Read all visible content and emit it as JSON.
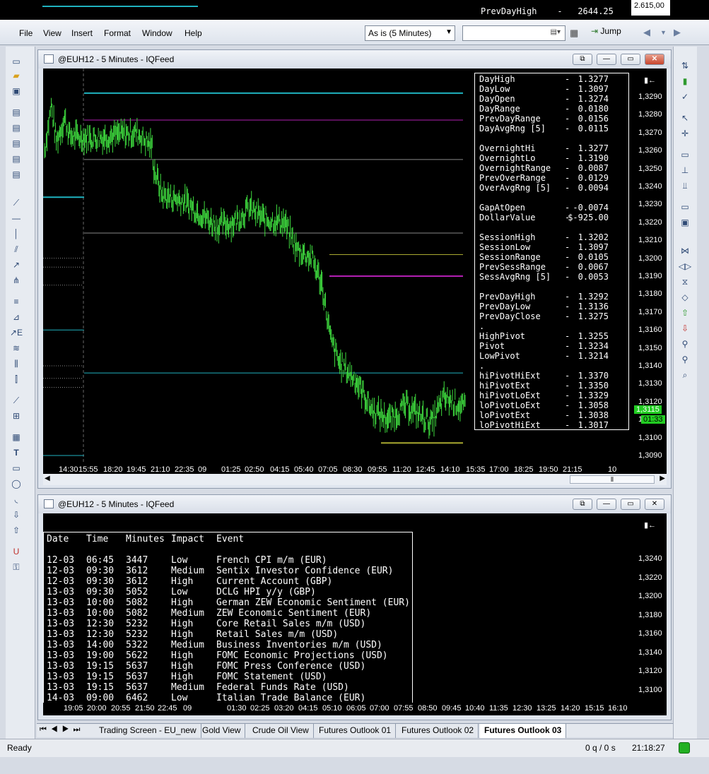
{
  "background_window": {
    "label": "PrevDayHigh",
    "dash": "-",
    "value": "2644.25",
    "axis": "2.615,00"
  },
  "menu": {
    "file": "File",
    "view": "View",
    "insert": "Insert",
    "format": "Format",
    "window": "Window",
    "help": "Help"
  },
  "toolbar": {
    "view_select": "As is (5 Minutes)",
    "jump": "Jump"
  },
  "chart_window": {
    "title": "@EUH12 - 5 Minutes - IQFeed",
    "stats": [
      {
        "label": "DayHigh",
        "value": "1.3277"
      },
      {
        "label": "DayLow",
        "value": "1.3097"
      },
      {
        "label": "DayOpen",
        "value": "1.3274"
      },
      {
        "label": "DayRange",
        "value": "0.0180"
      },
      {
        "label": "PrevDayRange",
        "value": "0.0156"
      },
      {
        "label": "DayAvgRng [5]",
        "value": "0.0115"
      },
      {
        "label": "",
        "value": ""
      },
      {
        "label": "OvernightHi",
        "value": "1.3277"
      },
      {
        "label": "OvernightLo",
        "value": "1.3190"
      },
      {
        "label": "OvernightRange",
        "value": "0.0087"
      },
      {
        "label": "PrevOverRange",
        "value": "0.0129"
      },
      {
        "label": "OverAvgRng [5]",
        "value": "0.0094"
      },
      {
        "label": "",
        "value": ""
      },
      {
        "label": "GapAtOpen",
        "value": "-0.0074"
      },
      {
        "label": "DollarValue",
        "value": "$-925.00"
      },
      {
        "label": "",
        "value": ""
      },
      {
        "label": "SessionHigh",
        "value": "1.3202"
      },
      {
        "label": "SessionLow",
        "value": "1.3097"
      },
      {
        "label": "SessionRange",
        "value": "0.0105"
      },
      {
        "label": "PrevSessRange",
        "value": "0.0067"
      },
      {
        "label": "SessAvgRng [5]",
        "value": "0.0053"
      },
      {
        "label": "",
        "value": ""
      },
      {
        "label": "PrevDayHigh",
        "value": "1.3292"
      },
      {
        "label": "PrevDayLow",
        "value": "1.3136"
      },
      {
        "label": "PrevDayClose",
        "value": "1.3275"
      },
      {
        "label": ".",
        "value": ""
      },
      {
        "label": "HighPivot",
        "value": "1.3255"
      },
      {
        "label": "Pivot",
        "value": "1.3234"
      },
      {
        "label": "LowPivot",
        "value": "1.3214"
      },
      {
        "label": ".",
        "value": ""
      },
      {
        "label": "hiPivotHiExt",
        "value": "1.3370"
      },
      {
        "label": "hiPivotExt",
        "value": "1.3350"
      },
      {
        "label": "hiPivotLoExt",
        "value": "1.3329"
      },
      {
        "label": "loPivotLoExt",
        "value": "1.3058"
      },
      {
        "label": "loPivotExt",
        "value": "1.3038"
      },
      {
        "label": "loPivotHiExt",
        "value": "1.3017"
      }
    ],
    "price_axis": [
      "1,3290",
      "1,3280",
      "1,3270",
      "1,3260",
      "1,3250",
      "1,3240",
      "1,3230",
      "1,3220",
      "1,3210",
      "1,3200",
      "1,3190",
      "1,3180",
      "1,3170",
      "1,3160",
      "1,3150",
      "1,3140",
      "1,3130",
      "1,3120",
      "1,3110",
      "1,3100",
      "1,3090"
    ],
    "last_price": "1,3115",
    "countdown": "01:33",
    "time_axis": [
      "14:30",
      "15:55",
      "18:20",
      "19:45",
      "21:10",
      "22:35",
      "09",
      "01:25",
      "02:50",
      "04:15",
      "05:40",
      "07:05",
      "08:30",
      "09:55",
      "11:20",
      "12:45",
      "14:10",
      "15:35",
      "17:00",
      "18:25",
      "19:50",
      "21:15",
      "10"
    ]
  },
  "events_window": {
    "title": "@EUH12 - 5 Minutes - IQFeed",
    "headers": {
      "date": "Date",
      "time": "Time",
      "minutes": "Minutes",
      "impact": "Impact",
      "event": "Event"
    },
    "rows": [
      {
        "date": "12-03",
        "time": "06:45",
        "minutes": "3447",
        "impact": "Low",
        "event": "French CPI m/m (EUR)"
      },
      {
        "date": "12-03",
        "time": "09:30",
        "minutes": "3612",
        "impact": "Medium",
        "event": "Sentix Investor Confidence (EUR)"
      },
      {
        "date": "12-03",
        "time": "09:30",
        "minutes": "3612",
        "impact": "High",
        "event": "Current Account (GBP)"
      },
      {
        "date": "13-03",
        "time": "09:30",
        "minutes": "5052",
        "impact": "Low",
        "event": "DCLG HPI y/y (GBP)"
      },
      {
        "date": "13-03",
        "time": "10:00",
        "minutes": "5082",
        "impact": "High",
        "event": "German ZEW Economic Sentiment (EUR)"
      },
      {
        "date": "13-03",
        "time": "10:00",
        "minutes": "5082",
        "impact": "Medium",
        "event": "ZEW Economic Sentiment (EUR)"
      },
      {
        "date": "13-03",
        "time": "12:30",
        "minutes": "5232",
        "impact": "High",
        "event": "Core Retail Sales m/m (USD)"
      },
      {
        "date": "13-03",
        "time": "12:30",
        "minutes": "5232",
        "impact": "High",
        "event": "Retail Sales m/m (USD)"
      },
      {
        "date": "13-03",
        "time": "14:00",
        "minutes": "5322",
        "impact": "Medium",
        "event": "Business Inventories m/m (USD)"
      },
      {
        "date": "13-03",
        "time": "19:00",
        "minutes": "5622",
        "impact": "High",
        "event": "FOMC Economic Projections (USD)"
      },
      {
        "date": "13-03",
        "time": "19:15",
        "minutes": "5637",
        "impact": "High",
        "event": "FOMC Press Conference (USD)"
      },
      {
        "date": "13-03",
        "time": "19:15",
        "minutes": "5637",
        "impact": "High",
        "event": "FOMC Statement (USD)"
      },
      {
        "date": "13-03",
        "time": "19:15",
        "minutes": "5637",
        "impact": "Medium",
        "event": "Federal Funds Rate (USD)"
      },
      {
        "date": "14-03",
        "time": "09:00",
        "minutes": "6462",
        "impact": "Low",
        "event": "Italian Trade Balance (EUR)"
      }
    ],
    "price_axis": [
      "1,3240",
      "1,3220",
      "1,3200",
      "1,3180",
      "1,3160",
      "1,3140",
      "1,3120",
      "1,3100"
    ],
    "time_axis": [
      "19:05",
      "20:00",
      "20:55",
      "21:50",
      "22:45",
      "09",
      "01:30",
      "02:25",
      "03:20",
      "04:15",
      "05:10",
      "06:05",
      "07:00",
      "07:55",
      "08:50",
      "09:45",
      "10:40",
      "11:35",
      "12:30",
      "13:25",
      "14:20",
      "15:15",
      "16:10"
    ]
  },
  "tabs": [
    "Trading Screen - EU_new",
    "Gold View",
    "Crude Oil View",
    "Futures Outlook 01",
    "Futures Outlook 02",
    "Futures Outlook 03"
  ],
  "status": {
    "ready": "Ready",
    "queue": "0 q / 0 s",
    "clock": "21:18:27"
  },
  "colors": {
    "bars": "#3fdc3f",
    "cyan_line": "#1fb2bf",
    "magenta_line": "#b21fb2",
    "olive_line": "#a8a830",
    "last_price_bg": "#22cc22"
  }
}
